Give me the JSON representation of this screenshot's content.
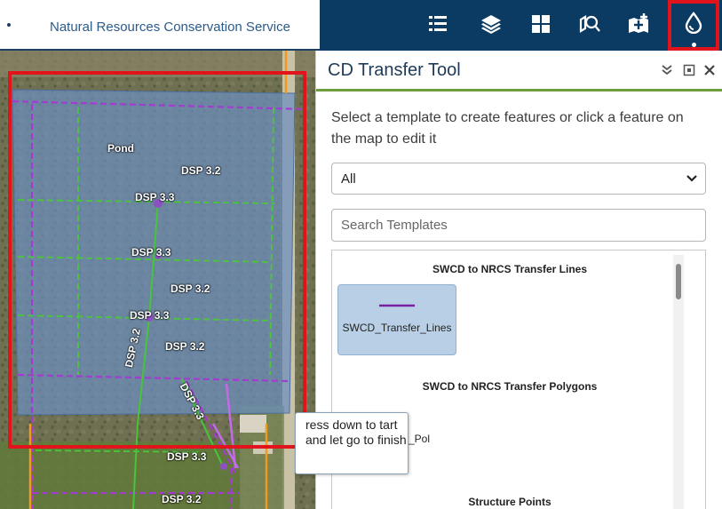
{
  "header": {
    "agency": "Natural Resources Conservation Service"
  },
  "toolbar": {
    "buttons": [
      {
        "icon": "list-icon"
      },
      {
        "icon": "layers-icon"
      },
      {
        "icon": "grid-icon"
      },
      {
        "icon": "map-search-icon"
      },
      {
        "icon": "add-map-icon"
      },
      {
        "icon": "water-drop-icon"
      }
    ]
  },
  "map": {
    "labels": [
      "Pond",
      "DSP 3.2",
      "DSP 3.3",
      "DSP 3.3",
      "DSP 3.2",
      "DSP 3.3",
      "DSP 3.2",
      "DSP 3.2",
      "DSP 3.3",
      "DSP 3.3",
      "DSP 3.2"
    ]
  },
  "panel": {
    "title": "CD Transfer Tool",
    "instruction": "Select a template to create features or click a feature on the map to edit it",
    "filter_value": "All",
    "search_placeholder": "Search Templates",
    "groups": [
      {
        "title": "SWCD to NRCS Transfer Lines",
        "items": [
          {
            "name": "SWCD_Transfer_Lines"
          }
        ]
      },
      {
        "title": "SWCD to NRCS Transfer Polygons",
        "items": [
          {
            "name": "SWCD_Transfer_Polygons",
            "visible": "sfer_Pol"
          }
        ]
      },
      {
        "title": "Structure Points",
        "items": []
      }
    ]
  },
  "tooltip": {
    "text": "Press down to start and let go to finish",
    "visible": "ress down to tart and let go to finish"
  },
  "colors": {
    "header_navy": "#0b3a63",
    "highlight_red": "#e1141c",
    "purple_line": "#7a1fa2",
    "green_line": "#4cc63a",
    "selected_template": "#b8cfe6"
  }
}
